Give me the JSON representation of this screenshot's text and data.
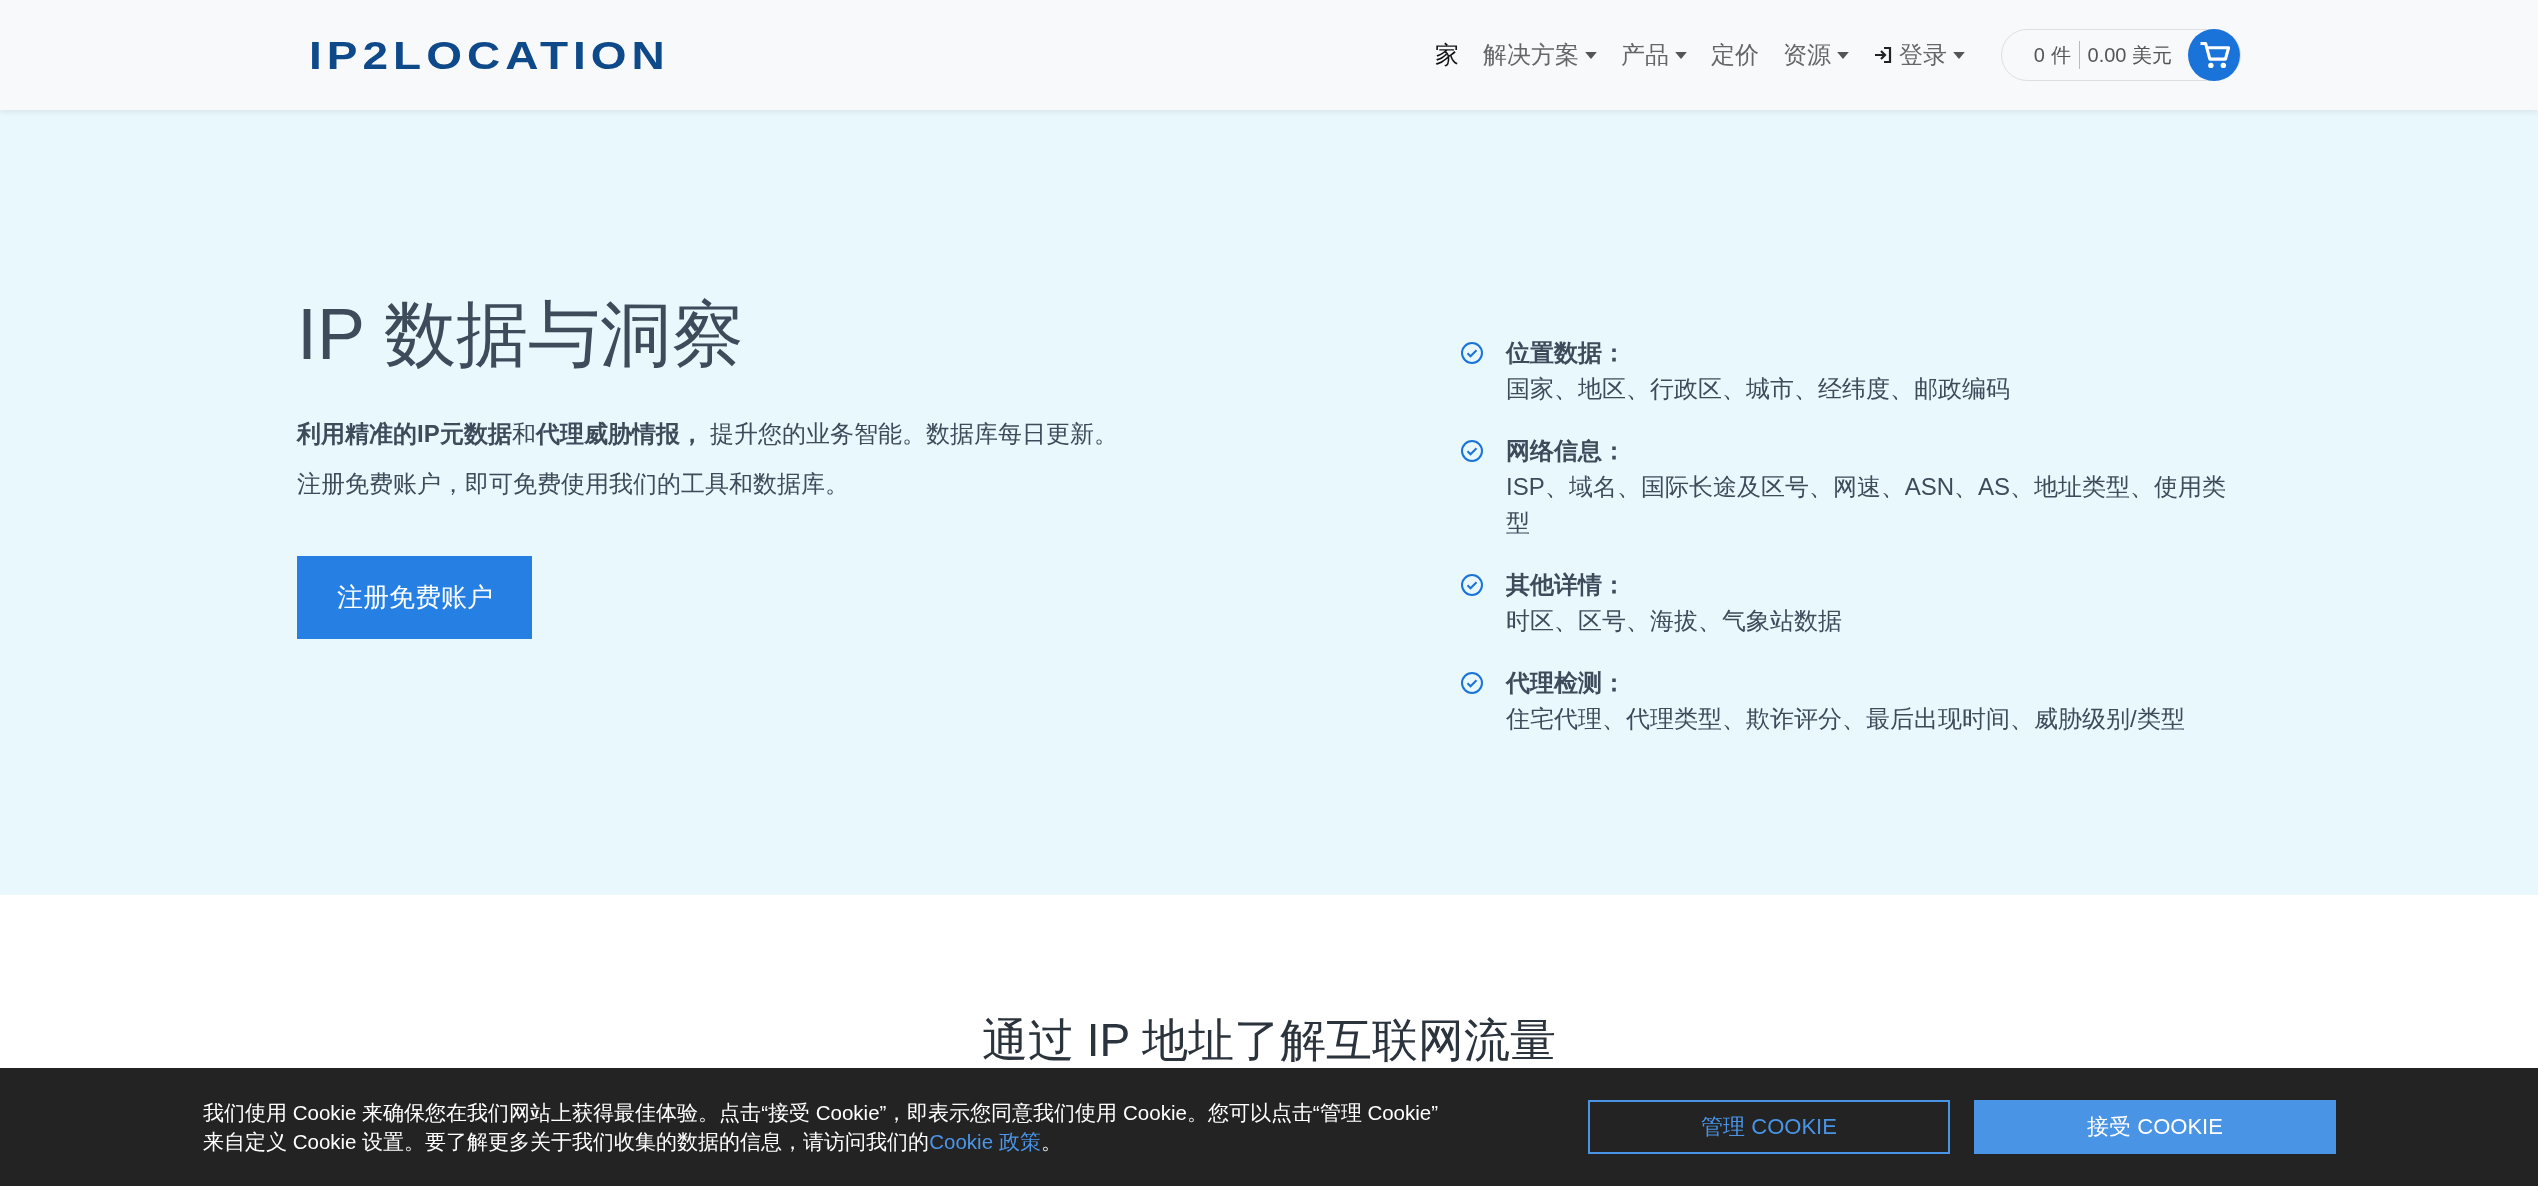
{
  "header": {
    "logo": "IP2LOCATION",
    "nav": [
      {
        "label": "家",
        "selected": true,
        "kind": "link"
      },
      {
        "label": "解决方案",
        "selected": false,
        "kind": "dropdown"
      },
      {
        "label": "产品",
        "selected": false,
        "kind": "dropdown"
      },
      {
        "label": "定价",
        "selected": false,
        "kind": "link"
      },
      {
        "label": "资源",
        "selected": false,
        "kind": "dropdown"
      },
      {
        "label": "登录",
        "selected": false,
        "kind": "login"
      }
    ],
    "cart": {
      "items": "0 件",
      "total": "0.00 美元"
    }
  },
  "hero": {
    "title": "IP 数据与洞察",
    "paragraphs": [
      "**利用精准的IP元数据**和**代理威胁情报，** 提升您的业务智能。数据库每日更新。",
      "注册免费账户，即可免费使用我们的工具和数据库。"
    ],
    "button": "注册免费账户",
    "features": [
      {
        "title": "位置数据：",
        "text": "国家、地区、行政区、城市、经纬度、邮政编码"
      },
      {
        "title": "网络信息：",
        "text": "ISP、域名、国际长途及区号、网速、ASN、AS、地址类型、使用类型"
      },
      {
        "title": "其他详情：",
        "text": "时区、区号、海拔、气象站数据"
      },
      {
        "title": "代理检测：",
        "text": "住宅代理、代理类型、欺诈评分、最后出现时间、威胁级别/类型"
      }
    ]
  },
  "section": {
    "title": "通过 IP 地址了解互联网流量"
  },
  "cookie_banner": {
    "lines": [
      "我们使用 Cookie 来确保您在我们网站上获得最佳体验。点击“接受 Cookie”，即表示您同意我们使用 Cookie。您可以点击“管理 Cookie”",
      "来自定义 Cookie 设置。要了解更多关于我们收集的数据的信息，请访问我们的"
    ],
    "link": "Cookie 政策",
    "suffix": "。",
    "buttons": [
      {
        "label": "管理 COOKIE",
        "kind": "outline"
      },
      {
        "label": "接受 COOKIE",
        "kind": "primary"
      }
    ]
  }
}
